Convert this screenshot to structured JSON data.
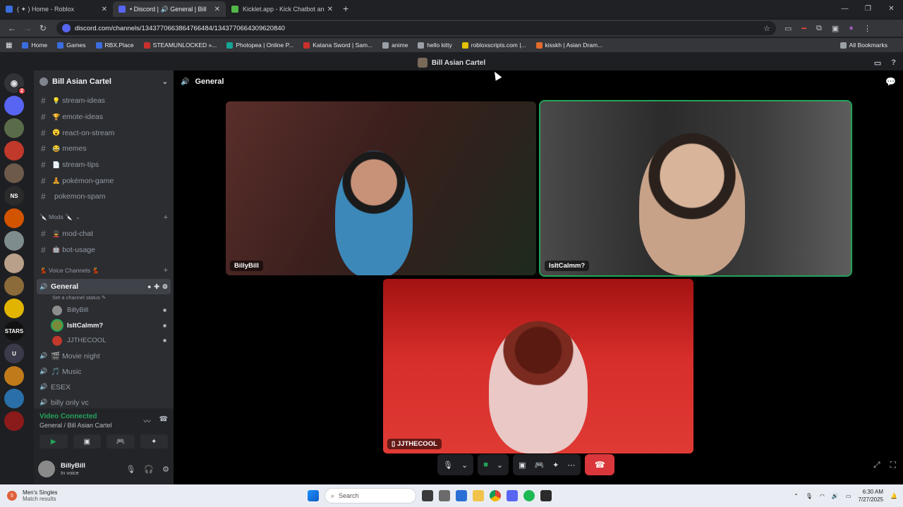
{
  "browser": {
    "tabs": [
      {
        "title": "( ✦ ) Home - Roblox",
        "color": "#3b6ddf",
        "active": false
      },
      {
        "title": "• Discord | 🔊 General | Bill",
        "color": "#5865f2",
        "active": true
      },
      {
        "title": "Kicklet.app - Kick Chatbot and",
        "color": "#53b848",
        "active": false
      }
    ],
    "url": "discord.com/channels/1343770663864766484/1343770664309620840",
    "bookmarks": [
      {
        "label": "Home",
        "color": "#3b6ddf"
      },
      {
        "label": "Games",
        "color": "#3b6ddf"
      },
      {
        "label": "RBX.Place",
        "color": "#3b6ddf"
      },
      {
        "label": "STEAMUNLOCKED »...",
        "color": "#c9302c"
      },
      {
        "label": "Photopea | Online P...",
        "color": "#18a497"
      },
      {
        "label": "Katana Sword | Sam...",
        "color": "#c9302c"
      },
      {
        "label": "anime",
        "color": "#9aa0a6"
      },
      {
        "label": "hello kitty",
        "color": "#9aa0a6"
      },
      {
        "label": "robloxscripts.com |...",
        "color": "#e3c200"
      },
      {
        "label": "kisskh | Asian Dram...",
        "color": "#e36b2c"
      }
    ],
    "all_bookmarks": "All Bookmarks"
  },
  "discord": {
    "top_title": "Bill Asian Cartel",
    "guild_name": "Bill Asian Cartel",
    "rail_badge": "2",
    "rail_servers": [
      {
        "label": "",
        "color": "#5865f2"
      },
      {
        "label": "",
        "color": "#5a6b4a"
      },
      {
        "label": "",
        "color": "#c0392b"
      },
      {
        "label": "",
        "color": "#6e5a4a"
      },
      {
        "label": "NS",
        "color": "#2b2b2b"
      },
      {
        "label": "",
        "color": "#d35400"
      },
      {
        "label": "",
        "color": "#7f8c8d"
      },
      {
        "label": "",
        "color": "#b8a08a"
      },
      {
        "label": "",
        "color": "#8b6b3a"
      },
      {
        "label": "",
        "color": "#e0b400"
      },
      {
        "label": "STARS",
        "color": "#111111"
      },
      {
        "label": "U",
        "color": "#3a3a4a"
      },
      {
        "label": "",
        "color": "#c07a1a"
      },
      {
        "label": "",
        "color": "#2a6fa8"
      },
      {
        "label": "",
        "color": "#8b1a1a"
      }
    ],
    "text_channels": [
      {
        "emoji": "💡",
        "name": "stream-ideas"
      },
      {
        "emoji": "🏆",
        "name": "emote-ideas"
      },
      {
        "emoji": "😮",
        "name": "react-on-stream"
      },
      {
        "emoji": "😂",
        "name": "memes"
      },
      {
        "emoji": "📄",
        "name": "stream-tips"
      },
      {
        "emoji": "🧘",
        "name": "pokémon-game"
      },
      {
        "emoji": "",
        "name": "pokemon-spam"
      }
    ],
    "mods_category": "🔪 Mods 🔪",
    "mod_channels": [
      {
        "emoji": "💂",
        "name": "mod-chat"
      },
      {
        "emoji": "🤖",
        "name": "bot-usage"
      }
    ],
    "voice_category": "💃 Voice Channels 💃",
    "active_voice": {
      "name": "General",
      "status": "Set a channel status ✎",
      "users": [
        {
          "name": "BillyBill",
          "speaking": false,
          "color": "#8d8d8d"
        },
        {
          "name": "IsItCalmm?",
          "speaking": true,
          "color": "#7a8a3a"
        },
        {
          "name": "JJTHECOOL",
          "speaking": false,
          "color": "#c0392b"
        }
      ]
    },
    "voice_channels": [
      {
        "name": "🎬 Movie night"
      },
      {
        "name": "🎵 Music"
      },
      {
        "name": "ESEX"
      },
      {
        "name": "billy only vc"
      }
    ],
    "voice_connected": {
      "title": "Video Connected",
      "sub": "General / Bill Asian Cartel"
    },
    "user": {
      "name": "BillyBill",
      "status": "In voice"
    },
    "stage": {
      "channel": "General",
      "tiles": [
        {
          "name": "BillyBill"
        },
        {
          "name": "IsItCalmm?"
        },
        {
          "name": "JJTHECOOL"
        }
      ]
    }
  },
  "taskbar": {
    "weather_badge": "5",
    "weather_title": "Men's Singles",
    "weather_sub": "Match results",
    "search_placeholder": "Search",
    "time": "6:30 AM",
    "date": "7/27/2025"
  }
}
